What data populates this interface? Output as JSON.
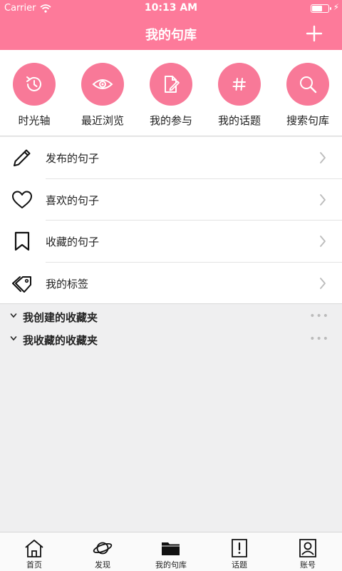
{
  "status_bar": {
    "carrier": "Carrier",
    "time": "10:13 AM"
  },
  "nav": {
    "title": "我的句库",
    "add_icon": "plus-icon"
  },
  "quick_actions": [
    {
      "label": "时光轴",
      "icon": "history-icon"
    },
    {
      "label": "最近浏览",
      "icon": "eye-icon"
    },
    {
      "label": "我的参与",
      "icon": "edit-document-icon"
    },
    {
      "label": "我的话题",
      "icon": "hashtag-icon"
    },
    {
      "label": "搜索句库",
      "icon": "search-icon"
    }
  ],
  "menu": [
    {
      "label": "发布的句子",
      "icon": "pencil-icon"
    },
    {
      "label": "喜欢的句子",
      "icon": "heart-icon"
    },
    {
      "label": "收藏的句子",
      "icon": "bookmark-icon"
    },
    {
      "label": "我的标签",
      "icon": "tag-icon"
    }
  ],
  "folders": [
    {
      "label": "我创建的收藏夹",
      "more": "•••"
    },
    {
      "label": "我收藏的收藏夹",
      "more": "•••"
    }
  ],
  "tabs": [
    {
      "label": "首页",
      "icon": "home-icon",
      "active": false
    },
    {
      "label": "发现",
      "icon": "planet-icon",
      "active": false
    },
    {
      "label": "我的句库",
      "icon": "folder-icon",
      "active": true
    },
    {
      "label": "话题",
      "icon": "topic-icon",
      "active": false
    },
    {
      "label": "账号",
      "icon": "account-icon",
      "active": false
    }
  ],
  "colors": {
    "accent": "#fd7a9a",
    "icon_circle": "#f87998",
    "background": "#efeff0"
  }
}
